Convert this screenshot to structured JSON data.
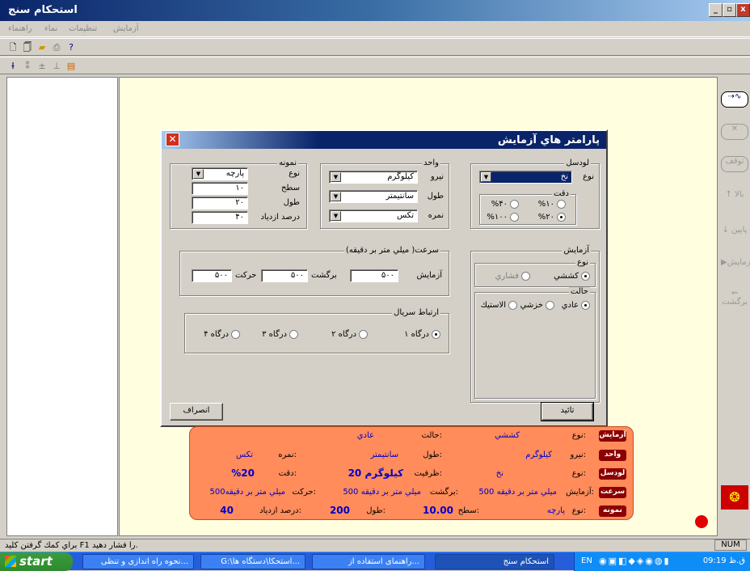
{
  "app": {
    "title": "استحکام سنج",
    "menu": [
      "راهنماء",
      "نماء",
      "تنظیمات",
      "آزمایش"
    ]
  },
  "window_buttons": {
    "min": "_",
    "max": "▫",
    "close": "x"
  },
  "right_toolbar": [
    "توقف",
    "بالا",
    "پایین",
    "آزمایش",
    "برگشت"
  ],
  "status": {
    "help": "براي کمك گرفتن کليد F1 را فشار دهيد.",
    "num": "NUM"
  },
  "taskbar": {
    "start": "start",
    "tasks": [
      "نحوه راه اندازی و تنظی...",
      "G:\\استحکا\\دستگاه ها...",
      "راهنمای استفاده از...",
      "استحکام سنج"
    ],
    "lang": "EN",
    "clock": "09:19 ق.ظ"
  },
  "dialog": {
    "title": "پارامتر هاي آزمايش",
    "loadcell": {
      "label": "لودسل",
      "type_label": "نوع",
      "type_value": "نخ",
      "accuracy_label": "دقت",
      "accuracy_options": [
        "%۱۰",
        "%۴۰",
        "%۲۰",
        "%۱۰۰"
      ],
      "accuracy_selected": "%۲۰"
    },
    "unit": {
      "label": "واحد",
      "force_label": "نيرو",
      "force_value": "کيلوگرم",
      "length_label": "طول",
      "length_value": "سانتيمتر",
      "count_label": "نمره",
      "count_value": "تکس"
    },
    "sample": {
      "label": "نمونه",
      "type_label": "نوع",
      "type_value": "پارچه",
      "surface_label": "سطح",
      "surface_value": "۱۰",
      "length_label": "طول",
      "length_value": "۲۰",
      "elong_label": "درصد ازدياد",
      "elong_value": "۴۰"
    },
    "speed": {
      "label": "سرعت( ميلي متر بر دقيقه)",
      "test_label": "آزمايش",
      "test_value": "۵۰۰",
      "return_label": "برگشت",
      "return_value": "۵۰۰",
      "move_label": "حرکت",
      "move_value": "۵۰۰"
    },
    "serial": {
      "label": "ارتباط سريال",
      "options": [
        "درگاه ۱",
        "درگاه ۲",
        "درگاه ۳",
        "درگاه ۴"
      ],
      "selected": "درگاه ۱"
    },
    "test": {
      "label": "آزمايش",
      "type_label": "نوع",
      "type_options": [
        "کششي",
        "فشاري"
      ],
      "type_selected": "کششي",
      "state_label": "حالت",
      "state_options": [
        "عادي",
        "خزشي",
        "الاستيك"
      ],
      "state_selected": "عادي"
    },
    "ok": "تائيد",
    "cancel": "انصراف"
  },
  "summary": {
    "rows": [
      {
        "tag": "آزمايش",
        "items": [
          [
            "نوع:",
            "كششي"
          ],
          [
            "حالت:",
            "عادي"
          ]
        ]
      },
      {
        "tag": "واحد",
        "items": [
          [
            "نيرو:",
            "كيلوگرم"
          ],
          [
            "طول:",
            "سانتيمتر"
          ],
          [
            "نمره:",
            "تكس"
          ]
        ]
      },
      {
        "tag": "لودسل",
        "items": [
          [
            "نوع:",
            "نخ"
          ],
          [
            "ظرفيت:",
            "20 كيلوگرم"
          ],
          [
            "دقت:",
            "%20"
          ]
        ]
      },
      {
        "tag": "سرعت",
        "items": [
          [
            "آزمايش:",
            "500 ميلي متر بر دقيقه"
          ],
          [
            "برگشت:",
            "500 ميلي متر بر دقيقه"
          ],
          [
            "حركت:",
            "500ميلي متر بر دقيقه"
          ]
        ]
      },
      {
        "tag": "نمونه",
        "items": [
          [
            "نوع:",
            "پارچه"
          ],
          [
            "سطح:",
            "10.00"
          ],
          [
            "طول:",
            "200"
          ],
          [
            "درصد ازدياد:",
            "40"
          ]
        ]
      }
    ]
  },
  "colors": {
    "canvas": "#ffffe0",
    "summary_bg": "#ff8c5a",
    "summary_tag": "#8b0000",
    "value": "#0000cc",
    "indicator": "#e00000"
  }
}
